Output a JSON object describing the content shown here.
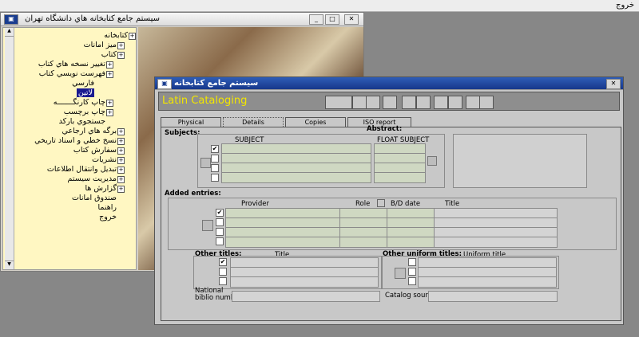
{
  "menubar": {
    "exit": "خروج"
  },
  "tree_window": {
    "title": "سیستم جامع کتابخانه هاي دانشگاه تهران",
    "items": [
      {
        "label": "كتابخانه"
      },
      {
        "label": "ميز امانات"
      },
      {
        "label": "كتاب"
      },
      {
        "label": "تغيير نسخه هاي كتاب"
      },
      {
        "label": "فهرست نويسي كتاب"
      },
      {
        "label": "فارسي"
      },
      {
        "label": "لاتين"
      },
      {
        "label": "چاپ كارنگـــــــه"
      },
      {
        "label": "چاپ برچسب"
      },
      {
        "label": "جستجوي باركد"
      },
      {
        "label": "برگه هاي ارجاعي"
      },
      {
        "label": "نسخ خطي و اسناد تاريخي"
      },
      {
        "label": "سفارش كتاب"
      },
      {
        "label": "نشريات"
      },
      {
        "label": "تبديل وانتقال اطلاعات"
      },
      {
        "label": "مديريت سيستم"
      },
      {
        "label": "گزارش ها"
      },
      {
        "label": "صندوق امانات"
      },
      {
        "label": "راهنما"
      },
      {
        "label": "خروج"
      }
    ]
  },
  "cat_window": {
    "title": "سیستم جامع كتابخانه",
    "header_title": "Latin Cataloging",
    "tabs": [
      {
        "label": "Physical Description"
      },
      {
        "label": "Details Description"
      },
      {
        "label": "Copies"
      },
      {
        "label": "ISO report"
      }
    ],
    "subjects": {
      "label": "Subjects:",
      "abstract_label": "Abstract:",
      "col_subject": "SUBJECT",
      "col_float": "FLOAT SUBJECT",
      "check": "✔"
    },
    "added_entries": {
      "label": "Added entries:",
      "col_provider": "Provider",
      "col_role": "Role",
      "col_bd": "B/D date",
      "col_title": "Title",
      "check": "✔"
    },
    "other_titles": {
      "label": "Other titles:",
      "col_title": "Title",
      "check": "✔"
    },
    "other_uniform_titles": {
      "label": "Other uniform titles:",
      "col_title": "Uniform title"
    },
    "national_biblio": {
      "label_line1": "National",
      "label_line2": "biblio number"
    },
    "catalog_source": {
      "label": "Catalog source"
    }
  }
}
